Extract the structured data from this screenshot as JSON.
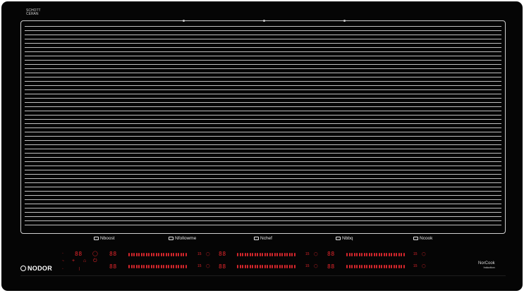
{
  "appliance": {
    "top_label": [
      "SCHOTT",
      "CERAN"
    ],
    "modes": [
      {
        "name": "Nboost",
        "icon": "boost-icon"
      },
      {
        "name": "Nfollowme",
        "icon": "followme-icon"
      },
      {
        "name": "Nchef",
        "icon": "chef-grid-icon"
      },
      {
        "name": "Nbbq",
        "icon": "bbq-icon"
      },
      {
        "name": "Ncook",
        "icon": "cook-hat-icon"
      }
    ],
    "brand_logo": "NODOR",
    "brand_right": {
      "line1": "NorCook",
      "line2": "Induction"
    },
    "controls": {
      "main_display_top": "88",
      "main_display_bottom": "88",
      "zone_displays": [
        "88",
        "88",
        "88",
        "88",
        "88",
        "88"
      ],
      "zone_end_labels": [
        "15",
        "15",
        "15",
        "15",
        "15",
        "15"
      ],
      "symbols": [
        "⏻",
        "+",
        "⌂",
        "◯"
      ]
    }
  },
  "colors": {
    "panel": "#050505",
    "display_red": "#e3252b",
    "lines": "#bfbfbf"
  }
}
